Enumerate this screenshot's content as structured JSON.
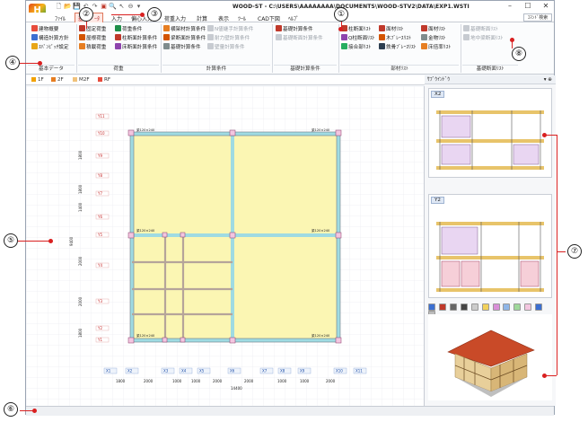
{
  "window": {
    "title": "WOOD-ST - C:\\USERS\\AAAAAAAA\\DOCUMENTS\\WOOD-STV2\\DATA\\EXP1.WSTI",
    "logo_text": "H",
    "min": "–",
    "max": "☐",
    "close": "✕"
  },
  "menu": {
    "items": [
      "ﾌｧｲﾙ",
      "基本ﾃﾞｰﾀ",
      "入力",
      "偏心入力",
      "荷重入力",
      "計算",
      "表示",
      "ﾂｰﾙ",
      "CAD下図",
      "ﾍﾙﾌﾟ"
    ],
    "active": "基本ﾃﾞｰﾀ",
    "command_search": "ｺﾏﾝﾄﾞ検索"
  },
  "ribbon": {
    "groups": [
      {
        "label": "基本データ",
        "buttons": [
          "建物概要",
          "構造計算方針",
          "ｽﾊﾟﾝﾋﾟｯﾁ設定"
        ]
      },
      {
        "label": "荷重",
        "buttons": [
          "固定荷重",
          "屋根荷重",
          "積載荷重",
          "荷重条件",
          "柱断面計算条件",
          "床断面計算条件"
        ]
      },
      {
        "label": "計算条件",
        "buttons": [
          "横架材計算条件",
          "梁断面計算条件",
          "基礎計算条件",
          "N値継手計算条件",
          "耐力壁計算条件",
          "壁量計算条件"
        ]
      },
      {
        "label": "基礎計算条件",
        "buttons": [
          "基礎計算条件",
          "基礎断面計算条件"
        ]
      },
      {
        "label": "部材ﾘｽﾄ",
        "buttons": [
          "柱断面ﾘｽﾄ",
          "Q柱断面ﾘｽﾄ",
          "接合部ﾘｽﾄ",
          "面材ﾘｽﾄ",
          "木ﾌﾞﾚｰｽﾘｽﾄ",
          "鉄骨ﾌﾞﾚｰｽﾘｽﾄ",
          "面材ﾘｽﾄ",
          "金物ﾘｽﾄ",
          "床倍率ﾘｽﾄ"
        ]
      },
      {
        "label": "基礎断面ﾘｽﾄ",
        "buttons": [
          "基礎断面ﾘｽﾄ",
          "地中梁断面ﾘｽﾄ"
        ]
      }
    ]
  },
  "floors": {
    "tabs": [
      "1F",
      "2F",
      "M2F",
      "RF"
    ],
    "active": "1F"
  },
  "plan": {
    "row_labels": [
      "Y11",
      "Y10",
      "Y9",
      "Y8",
      "Y7",
      "Y6",
      "Y5",
      "Y4",
      "Y3",
      "Y2",
      "Y1"
    ],
    "col_labels": [
      "X1",
      "X2",
      "X3",
      "X4",
      "X5",
      "X6",
      "X7",
      "X8",
      "X9",
      "X10",
      "X11"
    ],
    "left_dims": [
      "1800",
      "1800",
      "1400",
      "2000",
      "2000",
      "1800"
    ],
    "total_left_dim": "9400",
    "bottom_dims": [
      "1800",
      "2000",
      "1000",
      "1000",
      "2000",
      "2000",
      "1000",
      "1000",
      "2000"
    ],
    "total_bottom_dim": "14400",
    "beam_label": "梁120×240"
  },
  "side": {
    "title": "ｻﾌﾞｳｲﾝﾄﾞｳ",
    "panels": [
      "X2",
      "Y2"
    ]
  },
  "callouts": [
    "①",
    "②",
    "③",
    "④",
    "⑤",
    "⑥",
    "⑦",
    "⑧"
  ],
  "colors": {
    "accent": "#e0795d",
    "room_fill": "#fbf6b3",
    "wall": "#aee1e6",
    "marker": "#d92020"
  }
}
